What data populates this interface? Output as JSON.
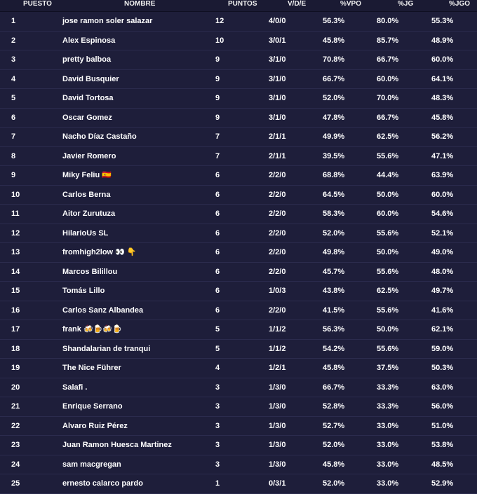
{
  "columns": {
    "puesto": "PUESTO",
    "nombre": "NOMBRE",
    "puntos": "PUNTOS",
    "vde": "V/D/E",
    "vpo": "%VPO",
    "jg": "%JG",
    "jgo": "%JGO"
  },
  "rows": [
    {
      "pos": "1",
      "name": "jose ramon soler salazar",
      "pts": "12",
      "vde": "4/0/0",
      "vpo": "56.3%",
      "jg": "80.0%",
      "jgo": "55.3%"
    },
    {
      "pos": "2",
      "name": "Alex Espinosa",
      "pts": "10",
      "vde": "3/0/1",
      "vpo": "45.8%",
      "jg": "85.7%",
      "jgo": "48.9%"
    },
    {
      "pos": "3",
      "name": "pretty balboa",
      "pts": "9",
      "vde": "3/1/0",
      "vpo": "70.8%",
      "jg": "66.7%",
      "jgo": "60.0%"
    },
    {
      "pos": "4",
      "name": "David Busquier",
      "pts": "9",
      "vde": "3/1/0",
      "vpo": "66.7%",
      "jg": "60.0%",
      "jgo": "64.1%"
    },
    {
      "pos": "5",
      "name": "David Tortosa",
      "pts": "9",
      "vde": "3/1/0",
      "vpo": "52.0%",
      "jg": "70.0%",
      "jgo": "48.3%"
    },
    {
      "pos": "6",
      "name": "Oscar Gomez",
      "pts": "9",
      "vde": "3/1/0",
      "vpo": "47.8%",
      "jg": "66.7%",
      "jgo": "45.8%"
    },
    {
      "pos": "7",
      "name": "Nacho Díaz Castaño",
      "pts": "7",
      "vde": "2/1/1",
      "vpo": "49.9%",
      "jg": "62.5%",
      "jgo": "56.2%"
    },
    {
      "pos": "8",
      "name": "Javier Romero",
      "pts": "7",
      "vde": "2/1/1",
      "vpo": "39.5%",
      "jg": "55.6%",
      "jgo": "47.1%"
    },
    {
      "pos": "9",
      "name": "Miky Feliu 🇪🇸",
      "pts": "6",
      "vde": "2/2/0",
      "vpo": "68.8%",
      "jg": "44.4%",
      "jgo": "63.9%"
    },
    {
      "pos": "10",
      "name": "Carlos Berna",
      "pts": "6",
      "vde": "2/2/0",
      "vpo": "64.5%",
      "jg": "50.0%",
      "jgo": "60.0%"
    },
    {
      "pos": "11",
      "name": "Aitor Zurutuza",
      "pts": "6",
      "vde": "2/2/0",
      "vpo": "58.3%",
      "jg": "60.0%",
      "jgo": "54.6%"
    },
    {
      "pos": "12",
      "name": "HilarioUs SL",
      "pts": "6",
      "vde": "2/2/0",
      "vpo": "52.0%",
      "jg": "55.6%",
      "jgo": "52.1%"
    },
    {
      "pos": "13",
      "name": "fromhigh2low 👀 👇",
      "pts": "6",
      "vde": "2/2/0",
      "vpo": "49.8%",
      "jg": "50.0%",
      "jgo": "49.0%"
    },
    {
      "pos": "14",
      "name": "Marcos Bilillou",
      "pts": "6",
      "vde": "2/2/0",
      "vpo": "45.7%",
      "jg": "55.6%",
      "jgo": "48.0%"
    },
    {
      "pos": "15",
      "name": "Tomás Lillo",
      "pts": "6",
      "vde": "1/0/3",
      "vpo": "43.8%",
      "jg": "62.5%",
      "jgo": "49.7%"
    },
    {
      "pos": "16",
      "name": "Carlos Sanz Albandea",
      "pts": "6",
      "vde": "2/2/0",
      "vpo": "41.5%",
      "jg": "55.6%",
      "jgo": "41.6%"
    },
    {
      "pos": "17",
      "name": "frank 🍻🍺🍻🍺",
      "pts": "5",
      "vde": "1/1/2",
      "vpo": "56.3%",
      "jg": "50.0%",
      "jgo": "62.1%"
    },
    {
      "pos": "18",
      "name": "Shandalarian de tranqui",
      "pts": "5",
      "vde": "1/1/2",
      "vpo": "54.2%",
      "jg": "55.6%",
      "jgo": "59.0%"
    },
    {
      "pos": "19",
      "name": "The Nice Führer",
      "pts": "4",
      "vde": "1/2/1",
      "vpo": "45.8%",
      "jg": "37.5%",
      "jgo": "50.3%"
    },
    {
      "pos": "20",
      "name": "Salafi .",
      "pts": "3",
      "vde": "1/3/0",
      "vpo": "66.7%",
      "jg": "33.3%",
      "jgo": "63.0%"
    },
    {
      "pos": "21",
      "name": "Enrique Serrano",
      "pts": "3",
      "vde": "1/3/0",
      "vpo": "52.8%",
      "jg": "33.3%",
      "jgo": "56.0%"
    },
    {
      "pos": "22",
      "name": "Alvaro Ruiz Pérez",
      "pts": "3",
      "vde": "1/3/0",
      "vpo": "52.7%",
      "jg": "33.0%",
      "jgo": "51.0%"
    },
    {
      "pos": "23",
      "name": "Juan Ramon Huesca Martinez",
      "pts": "3",
      "vde": "1/3/0",
      "vpo": "52.0%",
      "jg": "33.0%",
      "jgo": "53.8%"
    },
    {
      "pos": "24",
      "name": "sam macgregan",
      "pts": "3",
      "vde": "1/3/0",
      "vpo": "45.8%",
      "jg": "33.0%",
      "jgo": "48.5%"
    },
    {
      "pos": "25",
      "name": "ernesto calarco pardo",
      "pts": "1",
      "vde": "0/3/1",
      "vpo": "52.0%",
      "jg": "33.0%",
      "jgo": "52.9%"
    }
  ]
}
